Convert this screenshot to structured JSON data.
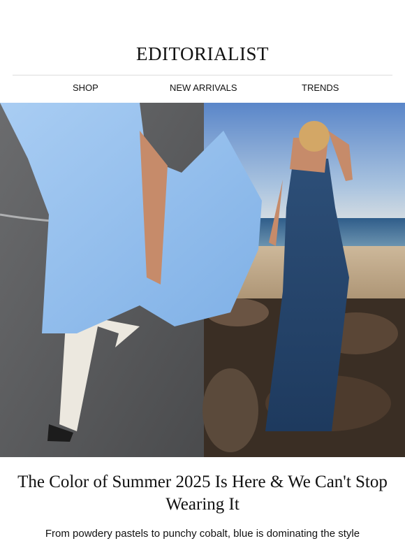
{
  "brand": {
    "logo_text": "EDITORIALIST"
  },
  "nav": {
    "items": [
      {
        "label": "SHOP"
      },
      {
        "label": "NEW ARRIVALS"
      },
      {
        "label": "TRENDS"
      }
    ]
  },
  "hero": {
    "left_image_desc": "",
    "right_image_desc": ""
  },
  "article": {
    "headline": "The Color of Summer 2025 Is Here & We Can't Stop Wearing It",
    "dek": "From powdery pastels to punchy cobalt, blue is dominating the style"
  }
}
